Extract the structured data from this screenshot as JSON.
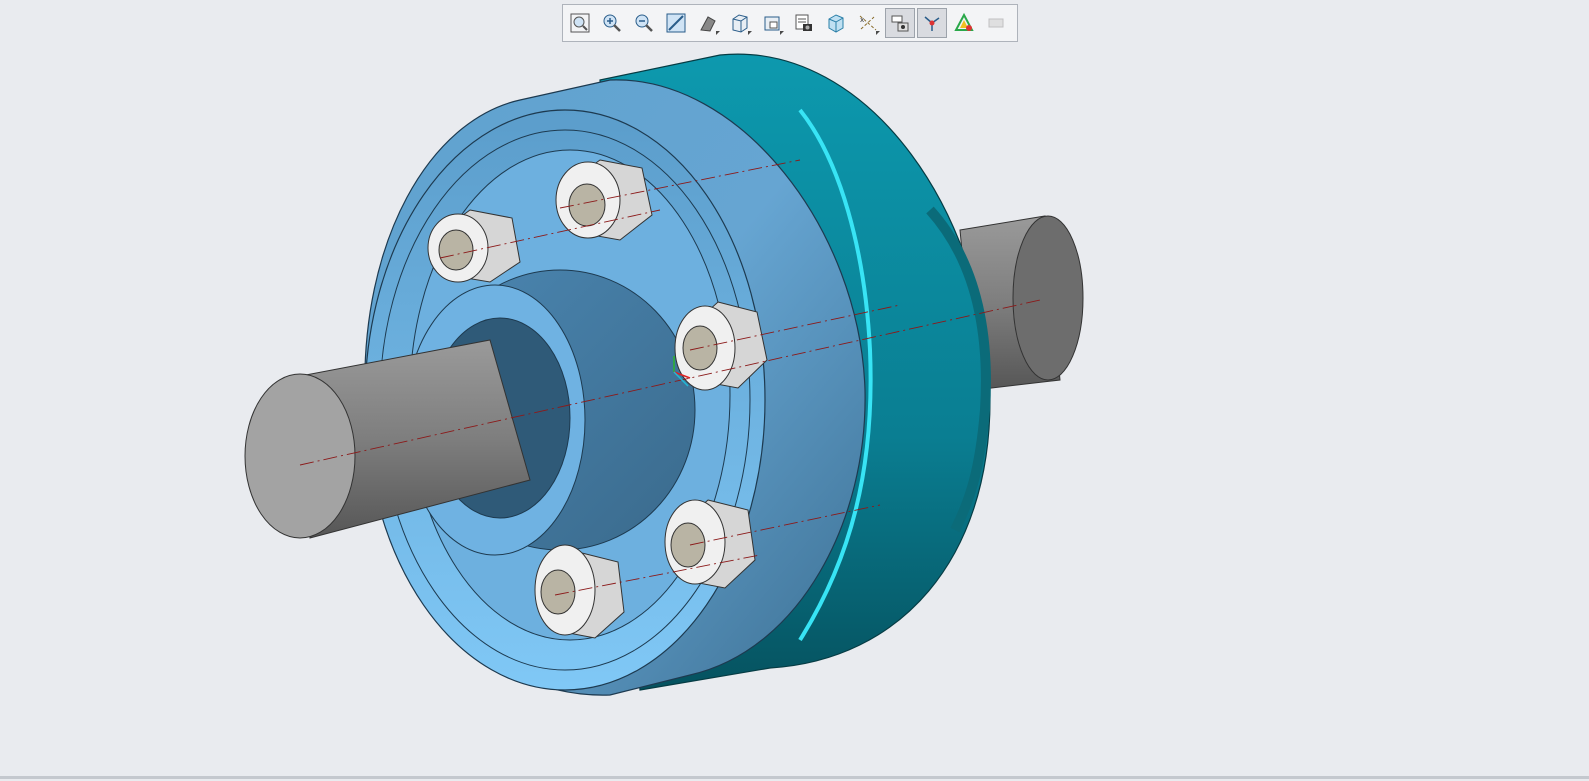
{
  "toolbar": {
    "buttons": [
      {
        "name": "zoom-to-fit",
        "icon": "zoom-fit-icon",
        "active": false,
        "flyout": false
      },
      {
        "name": "zoom-in",
        "icon": "zoom-in-icon",
        "active": false,
        "flyout": false
      },
      {
        "name": "zoom-out",
        "icon": "zoom-out-icon",
        "active": false,
        "flyout": false
      },
      {
        "name": "zoom-area",
        "icon": "zoom-area-icon",
        "active": false,
        "flyout": false
      },
      {
        "name": "display-style",
        "icon": "display-style-icon",
        "active": false,
        "flyout": true
      },
      {
        "name": "view-orientation",
        "icon": "view-cube-icon",
        "active": false,
        "flyout": true
      },
      {
        "name": "saved-views",
        "icon": "saved-views-icon",
        "active": false,
        "flyout": true
      },
      {
        "name": "view-manager",
        "icon": "view-manager-icon",
        "active": false,
        "flyout": false
      },
      {
        "name": "perspective",
        "icon": "perspective-box-icon",
        "active": false,
        "flyout": false
      },
      {
        "name": "datum-display",
        "icon": "datum-display-icon",
        "active": false,
        "flyout": true
      },
      {
        "name": "annotation-display",
        "icon": "annotation-display-icon",
        "active": true,
        "flyout": false
      },
      {
        "name": "spin-center",
        "icon": "spin-center-icon",
        "active": true,
        "flyout": false
      },
      {
        "name": "appearance",
        "icon": "appearance-icon",
        "active": false,
        "flyout": false
      },
      {
        "name": "section",
        "icon": "section-icon",
        "active": false,
        "flyout": false,
        "disabled": true
      }
    ]
  },
  "colors": {
    "background": "#e9ebef",
    "flange_front": "#6aa9d6",
    "flange_teal": "#0c8fa3",
    "shaft": "#8a8a8a",
    "nut": "#dcdcdc",
    "centerline": "#8b1a1a"
  }
}
